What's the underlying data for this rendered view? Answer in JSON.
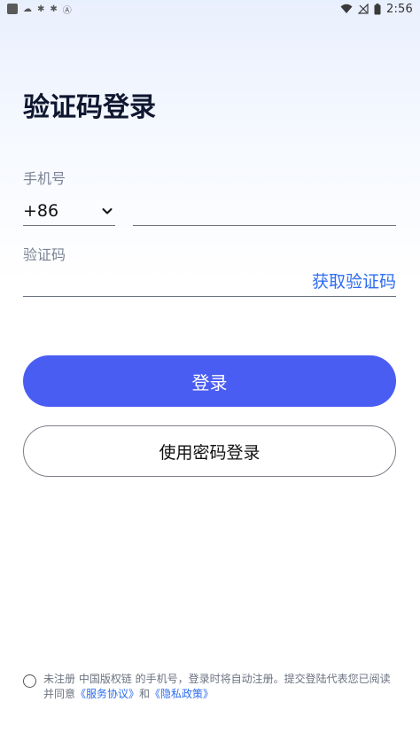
{
  "status_bar": {
    "time": "2:56",
    "left_icons": [
      "app-square-icon",
      "cloud-icon",
      "bug-icon",
      "bug-icon",
      "a-icon"
    ],
    "right_icons": [
      "wifi-icon",
      "signal-off-icon",
      "battery-icon"
    ]
  },
  "page": {
    "title": "验证码登录"
  },
  "form": {
    "phone_label": "手机号",
    "country_code": "+86",
    "phone_value": "",
    "code_label": "验证码",
    "code_value": "",
    "get_code_label": "获取验证码"
  },
  "buttons": {
    "login": "登录",
    "password_login": "使用密码登录"
  },
  "agreement": {
    "text_before": "未注册 中国版权链 的手机号，登录时将自动注册。提交登陆代表您已阅读并同意",
    "service_link": "《服务协议》",
    "and": "和",
    "privacy_link": "《隐私政策》"
  },
  "colors": {
    "accent": "#4a5df2",
    "link": "#2d6df0",
    "title": "#0f1730",
    "label": "#7b8394"
  }
}
